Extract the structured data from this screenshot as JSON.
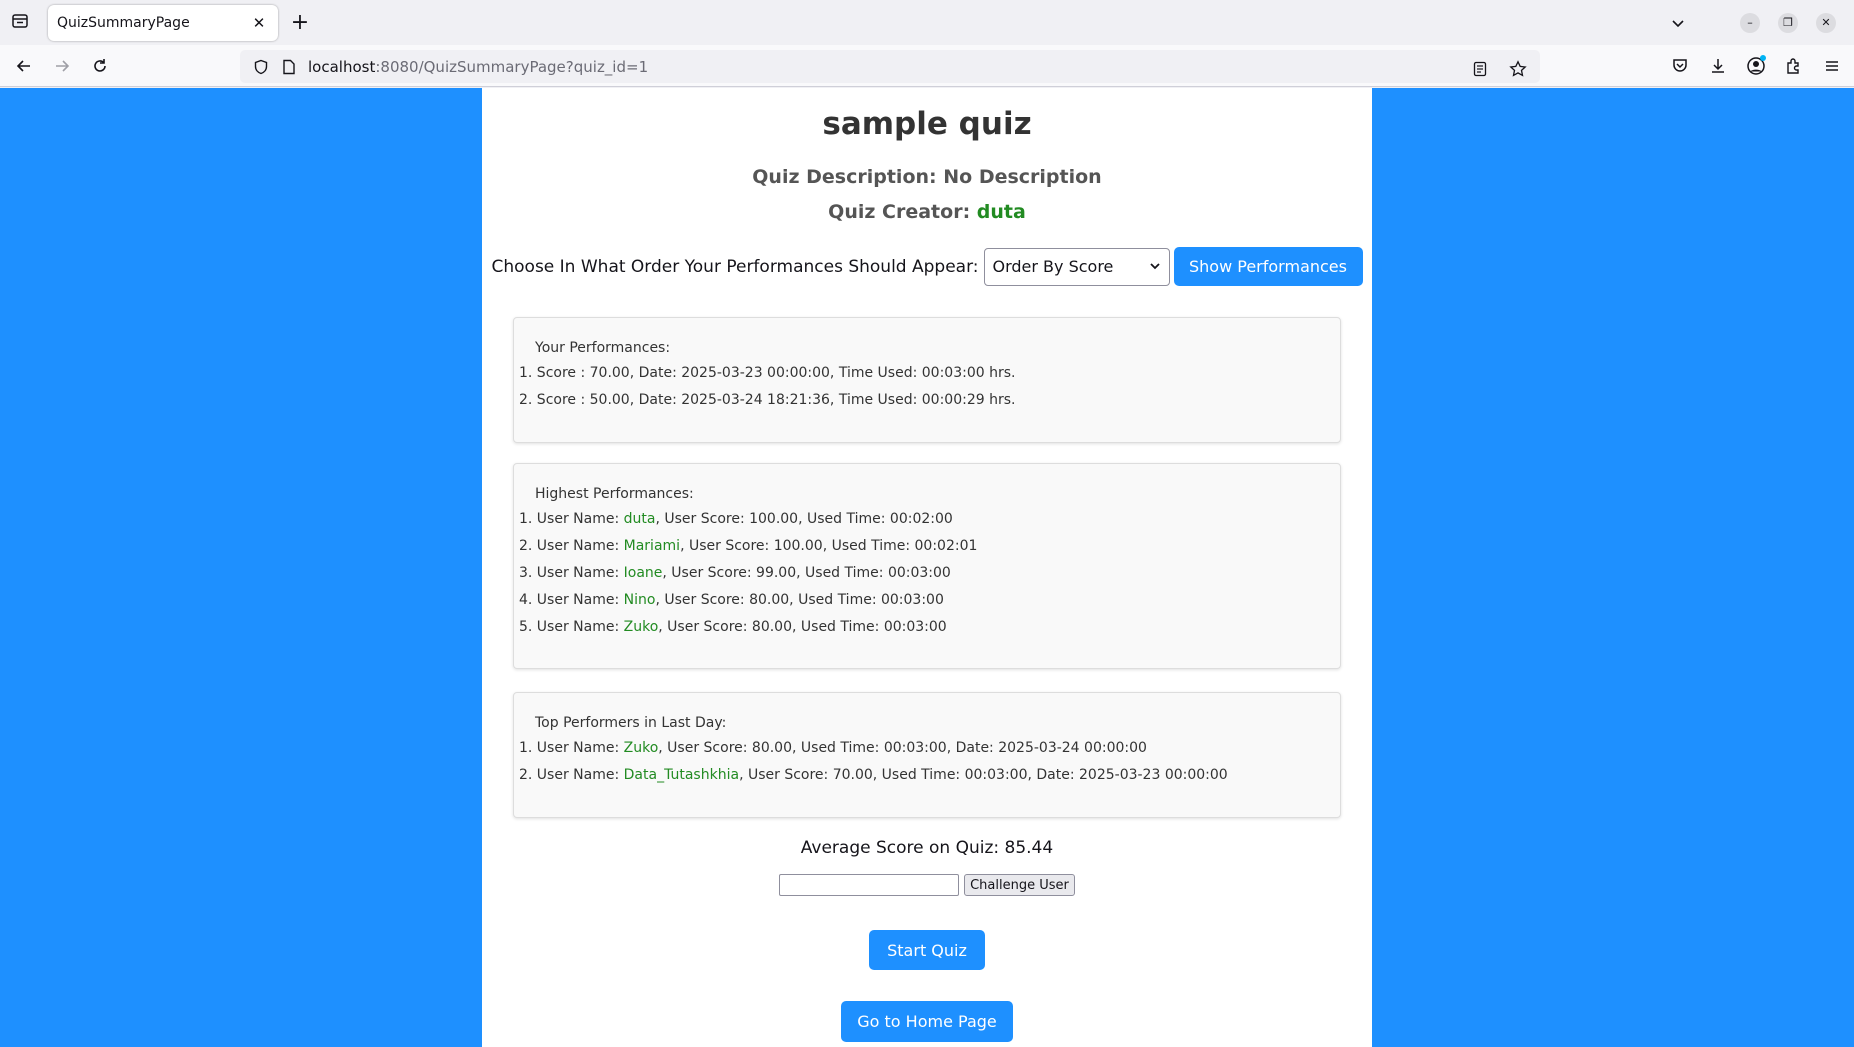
{
  "browser": {
    "tab_title": "QuizSummaryPage",
    "url_host": "localhost",
    "url_rest": ":8080/QuizSummaryPage?quiz_id=1"
  },
  "quiz": {
    "title": "sample quiz",
    "description_label": "Quiz Description:",
    "description_value": "No Description",
    "creator_label": "Quiz Creator:",
    "creator_name": "duta"
  },
  "order": {
    "label": "Choose In What Order Your Performances Should Appear:",
    "selected": "Order By Score",
    "button": "Show Performances"
  },
  "your_performances": {
    "title": "Your Performances:",
    "items": [
      "1. Score : 70.00, Date: 2025-03-23 00:00:00, Time Used: 00:03:00 hrs.",
      "2. Score : 50.00, Date: 2025-03-24 18:21:36, Time Used: 00:00:29 hrs."
    ]
  },
  "highest_performances": {
    "title": "Highest Performances:",
    "items": [
      {
        "prefix": "1. User Name: ",
        "name": "duta",
        "rest": ", User Score: 100.00, Used Time: 00:02:00"
      },
      {
        "prefix": "2. User Name: ",
        "name": "Mariami",
        "rest": ", User Score: 100.00, Used Time: 00:02:01"
      },
      {
        "prefix": "3. User Name: ",
        "name": "Ioane",
        "rest": ", User Score: 99.00, Used Time: 00:03:00"
      },
      {
        "prefix": "4. User Name: ",
        "name": "Nino",
        "rest": ", User Score: 80.00, Used Time: 00:03:00"
      },
      {
        "prefix": "5. User Name: ",
        "name": "Zuko",
        "rest": ", User Score: 80.00, Used Time: 00:03:00"
      }
    ]
  },
  "top_last_day": {
    "title": "Top Performers in Last Day:",
    "items": [
      {
        "prefix": "1. User Name: ",
        "name": "Zuko",
        "rest": ", User Score: 80.00, Used Time: 00:03:00, Date: 2025-03-24 00:00:00"
      },
      {
        "prefix": "2. User Name: ",
        "name": "Data_Tutashkhia",
        "rest": ", User Score: 70.00, Used Time: 00:03:00, Date: 2025-03-23 00:00:00"
      }
    ]
  },
  "average": "Average Score on Quiz: 85.44",
  "challenge": {
    "input_value": "",
    "button": "Challenge User"
  },
  "actions": {
    "start": "Start Quiz",
    "home": "Go to Home Page"
  },
  "colors": {
    "background": "#1e90ff",
    "accent": "#1e90ff",
    "username": "#228b22"
  }
}
